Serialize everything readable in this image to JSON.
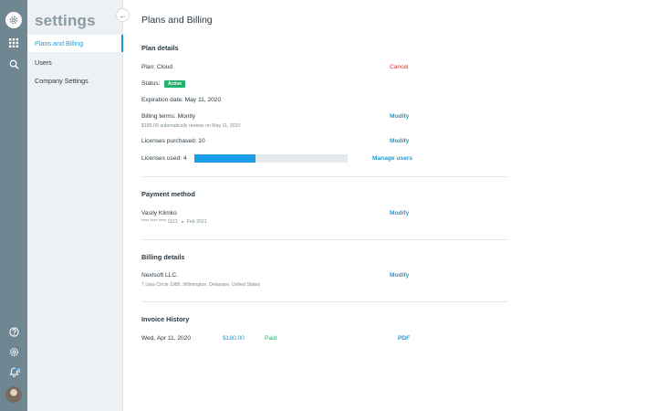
{
  "sidebar": {
    "title": "settings",
    "items": [
      {
        "label": "Plans and Billing",
        "active": true
      },
      {
        "label": "Users",
        "active": false
      },
      {
        "label": "Company Settings",
        "active": false
      }
    ]
  },
  "rail": {
    "notifications_count": "8",
    "icons": [
      "settings-logo-icon",
      "apps-grid-icon",
      "search-icon",
      "help-icon",
      "gear-icon",
      "bell-icon",
      "avatar"
    ]
  },
  "page": {
    "title": "Plans and Billing"
  },
  "plan_details": {
    "heading": "Plan details",
    "plan": "Plan: Cloud",
    "cancel": "Cancel",
    "status_label": "Status:",
    "status_badge": "Active",
    "expiration": "Expiration date: May 11, 2020",
    "billing_terms": "Billing terms: Montly",
    "billing_terms_sub": "$180.00 automatically renews on May 11, 2020",
    "billing_modify": "Modify",
    "licenses_purchased": "Licenses purchased: 10",
    "licenses_modify": "Modify",
    "licenses_used": "Licenses used: 4",
    "licenses_used_fraction": 0.4,
    "manage_users": "Manage users"
  },
  "payment_method": {
    "heading": "Payment method",
    "name": "Vasily Klimko",
    "card": "**** **** **** 1121",
    "expiry": "Feb 2021",
    "modify": "Modify"
  },
  "billing_details": {
    "heading": "Billing details",
    "company": "Nextsoft LLC.",
    "address": "7 Liwa Circle 1985, Wilmington, Delaware, United States",
    "modify": "Modify"
  },
  "invoice_history": {
    "heading": "Invoice History",
    "rows": [
      {
        "date": "Wed,  Apr 11, 2020",
        "amount": "$180.00",
        "status": "Paid",
        "file": "PDF"
      }
    ]
  },
  "colors": {
    "accent": "#1a9bd7",
    "rail": "#6f8693",
    "sidebar": "#eef1f3",
    "active_badge": "#20b36f",
    "cancel": "#d0342c"
  }
}
